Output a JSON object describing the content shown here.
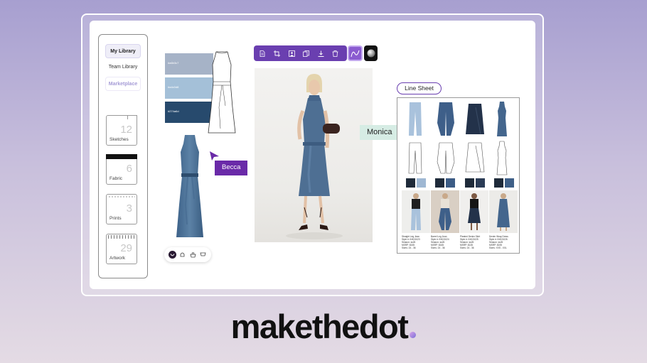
{
  "sidebar": {
    "links": [
      "My Library",
      "Team Library",
      "Marketplace"
    ],
    "folders": [
      {
        "count": "12",
        "label": "Sketches"
      },
      {
        "count": "6",
        "label": "Fabric"
      },
      {
        "count": "3",
        "label": "Prints"
      },
      {
        "count": "29",
        "label": "Artwork"
      }
    ]
  },
  "swatches": [
    {
      "hex": "#a6b3c7",
      "color": "#a6b3c7"
    },
    {
      "hex": "#a4c0d8",
      "color": "#a4c0d8"
    },
    {
      "hex": "#274a6d",
      "color": "#274a6d"
    }
  ],
  "collaborators": {
    "becca": {
      "name": "Becca",
      "color": "#6a2aa8"
    },
    "monica": {
      "name": "Monica",
      "color": "#d6ece4"
    }
  },
  "toolbar": {
    "icons": [
      "document-icon",
      "crop-icon",
      "person-icon",
      "copy-icon",
      "download-icon",
      "trash-icon",
      "curve-icon",
      "sphere-icon"
    ],
    "accent": "#6a3fb0"
  },
  "line_sheet": {
    "title": "Line Sheet",
    "items": [
      {
        "name": "Straight Leg Jean",
        "style": "Style #: INK21023",
        "season": "Season: ss26",
        "msrp": "MSRP: $155",
        "sizes": "Sizes: 24 - 36"
      },
      {
        "name": "Barrel Leg Jean",
        "style": "Style #: INK21024",
        "season": "Season: ss26",
        "msrp": "MSRP: $165",
        "sizes": "Sizes: 24 - 36"
      },
      {
        "name": "Pleated Denim Skirt",
        "style": "Style #: INK21025",
        "season": "Season: ss26",
        "msrp": "MSRP: $135",
        "sizes": "Sizes: 24 - 36"
      },
      {
        "name": "Denim Wrap Dress",
        "style": "Style #: INK21026",
        "season": "Season: ss26",
        "msrp": "MSRP: $195",
        "sizes": "Sizes: XXS - XXL"
      }
    ]
  },
  "brand": {
    "logo": "makethedot"
  }
}
